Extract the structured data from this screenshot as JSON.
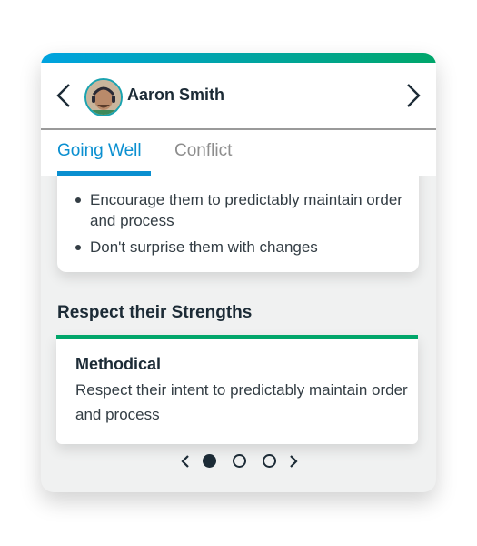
{
  "header": {
    "user_name": "Aaron Smith",
    "prev_icon": "chevron-left-icon",
    "next_icon": "chevron-right-icon",
    "avatar": "avatar-photo"
  },
  "tabs": [
    {
      "label": "Going Well",
      "active": true
    },
    {
      "label": "Conflict",
      "active": false
    }
  ],
  "going_well": {
    "bullets": [
      "Encourage them to predictably maintain order and process",
      "Don't surprise them with changes"
    ]
  },
  "strengths": {
    "section_title": "Respect their Strengths",
    "card_title": "Methodical",
    "card_text": "Respect their intent to predictably maintain order and process"
  },
  "pager": {
    "total_pages": 3,
    "current_page": 1
  },
  "colors": {
    "accent_blue": "#0a8fd0",
    "accent_green": "#00a66a",
    "text_dark": "#1c2b36"
  }
}
